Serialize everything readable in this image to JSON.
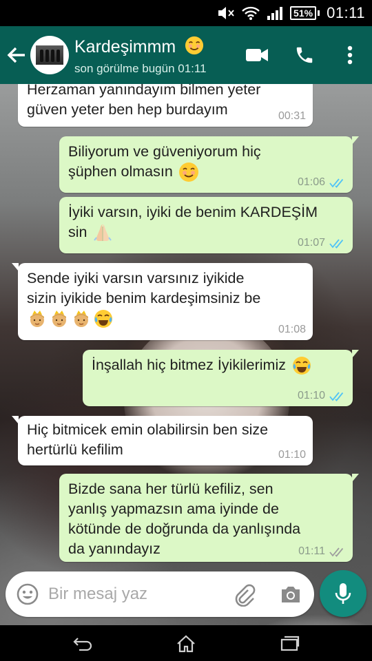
{
  "status_bar": {
    "battery": "51%",
    "time": "01:11"
  },
  "header": {
    "contact_name": "Kardeşimmm",
    "name_emoji": "smiling-face-emoji",
    "last_seen": "son görülme bugün 01:11",
    "icons": [
      "back-arrow-icon",
      "video-call-icon",
      "phone-icon",
      "more-options-icon"
    ]
  },
  "messages": [
    {
      "direction": "incoming",
      "lines": [
        "Herzaman yanındayım bilmen yeter",
        "güven yeter ben hep burdayım"
      ],
      "time": "00:31"
    },
    {
      "direction": "outgoing",
      "lines": [
        "Biliyorum ve güveniyorum hiç",
        "şüphen olmasın"
      ],
      "emoji": [
        "smiling-face-emoji"
      ],
      "time": "01:06",
      "status": "read"
    },
    {
      "direction": "outgoing",
      "lines": [
        "İyiki varsın, iyiki de benim KARDEŞİM",
        "sin"
      ],
      "emoji": [
        "folded-hands-emoji"
      ],
      "time": "01:07",
      "status": "read"
    },
    {
      "direction": "incoming",
      "lines": [
        "Sende iyiki varsın varsınız iyikide",
        "sizin iyikide benim kardeşimsiniz be"
      ],
      "emoji": [
        "princess-emoji",
        "princess-emoji",
        "princess-emoji",
        "tears-of-joy-emoji"
      ],
      "time": "01:08"
    },
    {
      "direction": "outgoing",
      "lines": [
        "İnşallah hiç bitmez İyikilerimiz"
      ],
      "emoji": [
        "tears-of-joy-emoji"
      ],
      "time": "01:10",
      "status": "read"
    },
    {
      "direction": "incoming",
      "lines": [
        "Hiç bitmicek emin olabilirsin ben size",
        "hertürlü kefilim"
      ],
      "time": "01:10"
    },
    {
      "direction": "outgoing",
      "lines": [
        "Bizde sana her türlü kefiliz, sen",
        "yanlış yapmazsın ama iyinde de",
        "kötünde de doğrunda da yanlışında",
        "da yanındayız"
      ],
      "time": "01:11",
      "status": "delivered"
    }
  ],
  "input": {
    "placeholder": "Bir mesaj yaz"
  },
  "colors": {
    "header": "#075e54",
    "outgoing_bubble": "#dcf8c6",
    "incoming_bubble": "#ffffff",
    "mic_button": "#128c7e",
    "read_ticks": "#4fc3f7",
    "delivered_ticks": "#9e9e9e"
  },
  "nav_icons": [
    "back-icon",
    "home-icon",
    "recents-icon"
  ]
}
